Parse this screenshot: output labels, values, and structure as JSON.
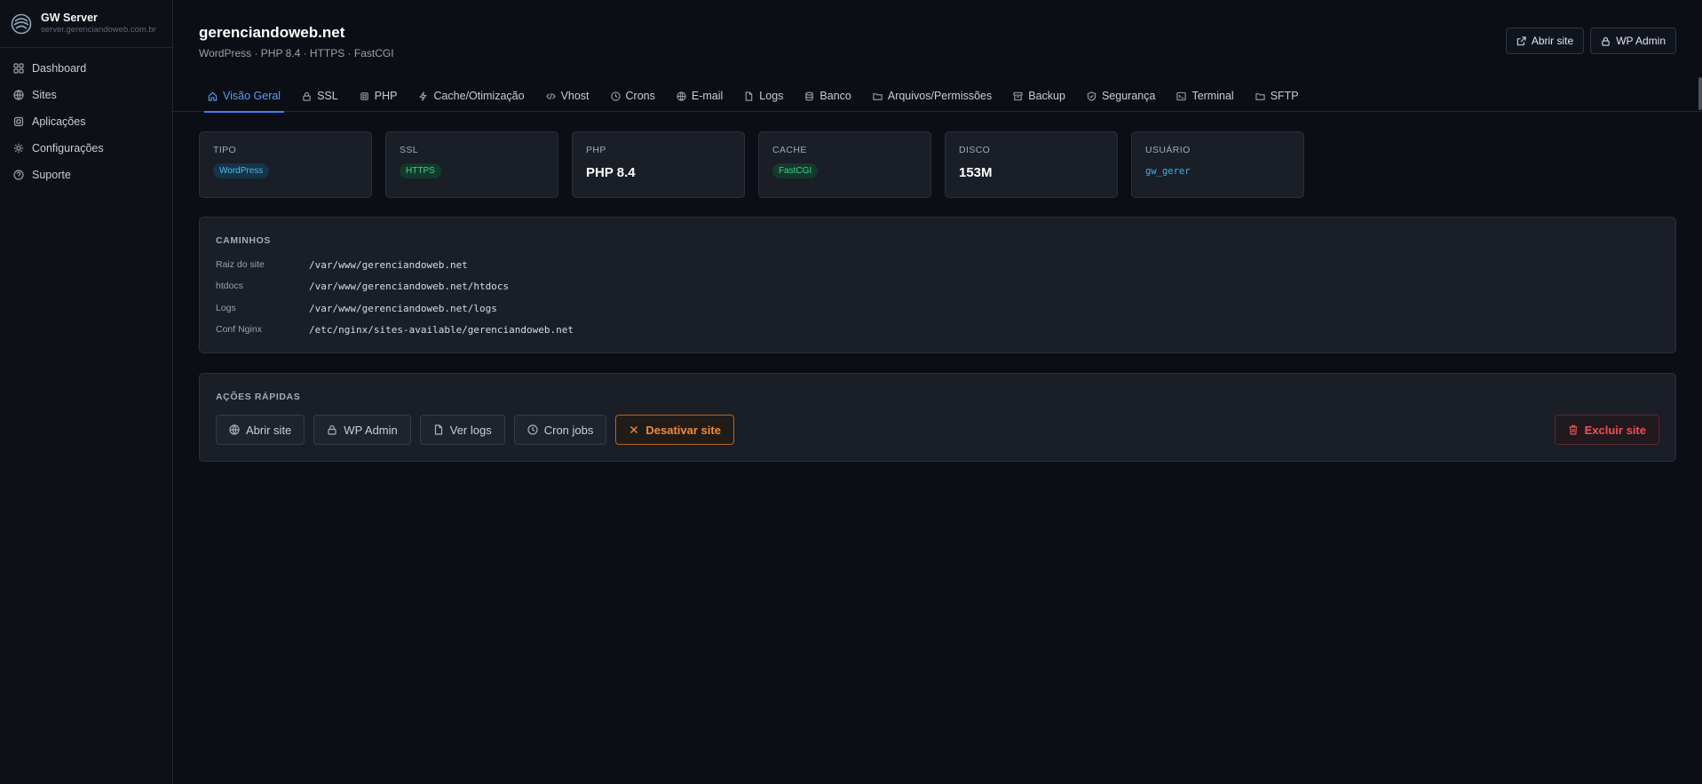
{
  "brand": {
    "name": "GW Server",
    "host": "server.gerenciandoweb.com.br"
  },
  "sidebar": {
    "items": [
      {
        "label": "Dashboard",
        "icon": "grid-icon"
      },
      {
        "label": "Sites",
        "icon": "globe-icon"
      },
      {
        "label": "Aplicações",
        "icon": "app-icon"
      },
      {
        "label": "Configurações",
        "icon": "gear-icon"
      },
      {
        "label": "Suporte",
        "icon": "help-icon"
      }
    ]
  },
  "header": {
    "title": "gerenciandoweb.net",
    "subtitle": "WordPress · PHP 8.4 · HTTPS · FastCGI",
    "open_site": "Abrir site",
    "wp_admin": "WP Admin"
  },
  "tabs": [
    {
      "label": "Visão Geral",
      "icon": "home-icon",
      "active": true
    },
    {
      "label": "SSL",
      "icon": "lock-icon"
    },
    {
      "label": "PHP",
      "icon": "chip-icon"
    },
    {
      "label": "Cache/Otimização",
      "icon": "bolt-icon"
    },
    {
      "label": "Vhost",
      "icon": "code-icon"
    },
    {
      "label": "Crons",
      "icon": "clock-icon"
    },
    {
      "label": "E-mail",
      "icon": "globe-icon"
    },
    {
      "label": "Logs",
      "icon": "file-icon"
    },
    {
      "label": "Banco",
      "icon": "database-icon"
    },
    {
      "label": "Arquivos/Permissões",
      "icon": "folder-icon"
    },
    {
      "label": "Backup",
      "icon": "archive-icon"
    },
    {
      "label": "Segurança",
      "icon": "shield-icon"
    },
    {
      "label": "Terminal",
      "icon": "terminal-icon"
    },
    {
      "label": "SFTP",
      "icon": "folder-icon"
    }
  ],
  "cards": {
    "tipo": {
      "label": "TIPO",
      "value": "WordPress"
    },
    "ssl": {
      "label": "SSL",
      "value": "HTTPS"
    },
    "php": {
      "label": "PHP",
      "value": "PHP 8.4"
    },
    "cache": {
      "label": "CACHE",
      "value": "FastCGI"
    },
    "disco": {
      "label": "DISCO",
      "value": "153M"
    },
    "usuario": {
      "label": "USUÁRIO",
      "value": "gw_gerer"
    }
  },
  "paths": {
    "title": "CAMINHOS",
    "rows": [
      {
        "label": "Raiz do site",
        "value": "/var/www/gerenciandoweb.net"
      },
      {
        "label": "htdocs",
        "value": "/var/www/gerenciandoweb.net/htdocs"
      },
      {
        "label": "Logs",
        "value": "/var/www/gerenciandoweb.net/logs"
      },
      {
        "label": "Conf Nginx",
        "value": "/etc/nginx/sites-available/gerenciandoweb.net"
      }
    ]
  },
  "actions": {
    "title": "AÇÕES RÁPIDAS",
    "open_site": "Abrir site",
    "wp_admin": "WP Admin",
    "view_logs": "Ver logs",
    "cron_jobs": "Cron jobs",
    "disable_site": "Desativar site",
    "delete_site": "Excluir site"
  },
  "colors": {
    "accent": "#3b82f6",
    "warning": "#f08a3c",
    "danger": "#ef4f58",
    "info": "#4db8ee",
    "success": "#3fd18a"
  }
}
